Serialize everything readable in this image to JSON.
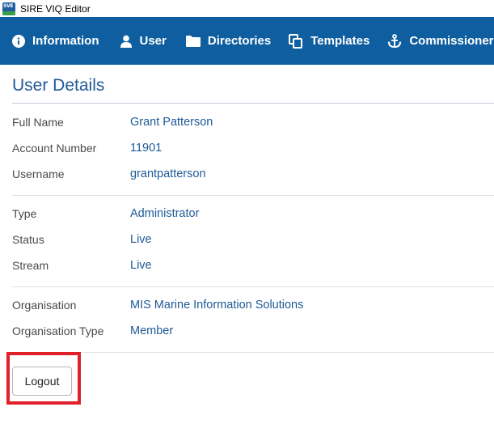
{
  "window": {
    "title": "SIRE VIQ Editor",
    "icon": "app-logo-icon",
    "icon_text": "SVE"
  },
  "nav": {
    "items": [
      {
        "label": "Information",
        "icon": "info-icon"
      },
      {
        "label": "User",
        "icon": "user-icon"
      },
      {
        "label": "Directories",
        "icon": "folder-icon"
      },
      {
        "label": "Templates",
        "icon": "copy-icon"
      },
      {
        "label": "Commissioners",
        "icon": "anchor-icon"
      }
    ]
  },
  "page": {
    "title": "User Details"
  },
  "details": {
    "full_name": {
      "label": "Full Name",
      "value": "Grant Patterson"
    },
    "account_number": {
      "label": "Account Number",
      "value": "11901"
    },
    "username": {
      "label": "Username",
      "value": "grantpatterson"
    },
    "type": {
      "label": "Type",
      "value": "Administrator"
    },
    "status": {
      "label": "Status",
      "value": "Live"
    },
    "stream": {
      "label": "Stream",
      "value": "Live"
    },
    "organisation": {
      "label": "Organisation",
      "value": "MIS Marine Information Solutions"
    },
    "organisation_type": {
      "label": "Organisation Type",
      "value": "Member"
    }
  },
  "actions": {
    "logout_label": "Logout"
  },
  "colors": {
    "nav_bg": "#0f5fa0",
    "accent_text": "#1e5a97",
    "highlight": "#e0202a"
  }
}
